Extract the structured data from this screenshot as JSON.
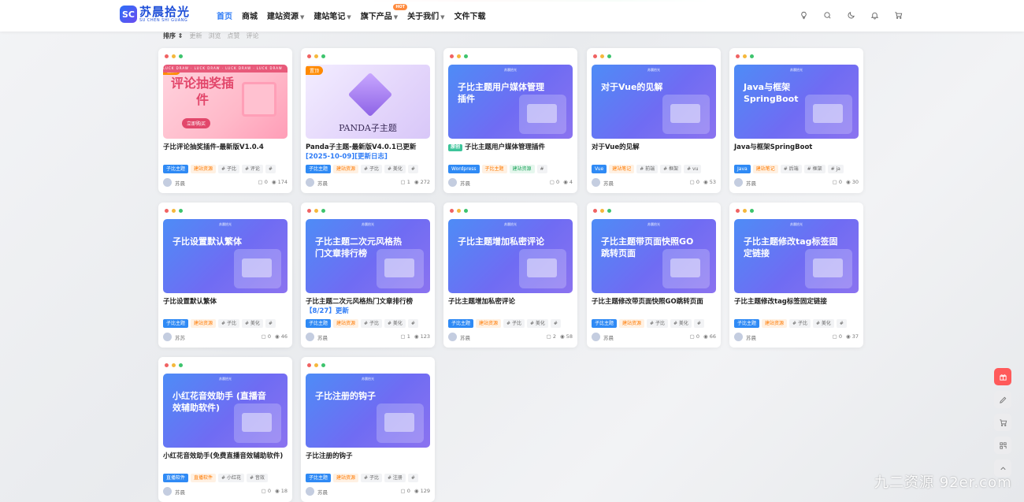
{
  "site": {
    "logo_mark": "SC",
    "logo_name": "苏晨拾光",
    "logo_sub": "SU CHEN SHI GUANG"
  },
  "nav": {
    "items": [
      {
        "label": "首页",
        "active": true
      },
      {
        "label": "商城"
      },
      {
        "label": "建站资源",
        "dropdown": true
      },
      {
        "label": "建站笔记",
        "dropdown": true
      },
      {
        "label": "旗下产品",
        "dropdown": true,
        "badge": "HOT"
      },
      {
        "label": "关于我们",
        "dropdown": true
      },
      {
        "label": "文件下载"
      }
    ],
    "icons": [
      "bulb-icon",
      "search-icon",
      "moon-icon",
      "bell-icon",
      "cart-icon"
    ]
  },
  "sort": {
    "label": "排序",
    "options": [
      "更新",
      "浏览",
      "点赞",
      "评论"
    ]
  },
  "posts": [
    {
      "title": "子比评论抽奖插件-最新版V1.0.4",
      "thumb": "评论抽奖插件",
      "ribbon": "置顶",
      "style": "pink",
      "tags": [
        "子比主题",
        "建站资源",
        "# 子比",
        "# 评论",
        "#"
      ],
      "author": "苏晨",
      "comments": "0",
      "views": "174"
    },
    {
      "title": "Panda子主题-最新版V4.0.1已更新",
      "subtitle": "[2025-10-09][更新日志]",
      "thumb": "PANDA子主题",
      "ribbon": "置顶",
      "style": "panda",
      "tags": [
        "子比主题",
        "建站资源",
        "# 子比",
        "# 美化",
        "#"
      ],
      "author": "苏晨",
      "comments": "1",
      "views": "272"
    },
    {
      "title": "子比主题用户媒体管理插件",
      "new": "原创",
      "thumb": "子比主题用户媒体管理插件",
      "tags": [
        "Wordpress",
        "子比主题",
        "建站资源",
        "#"
      ],
      "author": "苏晨",
      "comments": "0",
      "views": "4"
    },
    {
      "title": "对于Vue的见解",
      "thumb": "对于Vue的见解",
      "tags": [
        "Vue",
        "建站笔记",
        "# 前端",
        "# 框架",
        "# vu"
      ],
      "author": "苏晨",
      "comments": "0",
      "views": "53"
    },
    {
      "title": "Java与框架SpringBoot",
      "thumb": "Java与框架 SpringBoot",
      "tags": [
        "Java",
        "建站笔记",
        "# 后端",
        "# 框架",
        "# ja"
      ],
      "author": "苏晨",
      "comments": "0",
      "views": "30"
    },
    {
      "title": "子比设置默认繁体",
      "thumb": "子比设置默认繁体",
      "tags": [
        "子比主题",
        "建站资源",
        "# 子比",
        "# 美化",
        "#"
      ],
      "author": "苏苏",
      "comments": "0",
      "views": "46"
    },
    {
      "title": "子比主题二次元风格热门文章排行榜",
      "subtitle": "【8/27】更新",
      "thumb": "子比主题二次元风格热门文章排行榜",
      "tags": [
        "子比主题",
        "建站资源",
        "# 子比",
        "# 美化",
        "#"
      ],
      "author": "苏晨",
      "comments": "1",
      "views": "123"
    },
    {
      "title": "子比主题增加私密评论",
      "thumb": "子比主题增加私密评论",
      "tags": [
        "子比主题",
        "建站资源",
        "# 子比",
        "# 美化",
        "#"
      ],
      "author": "苏晨",
      "comments": "2",
      "views": "58"
    },
    {
      "title": "子比主题修改带页面快照GO跳转页面",
      "thumb": "子比主题带页面快照GO跳转页面",
      "tags": [
        "子比主题",
        "建站资源",
        "# 子比",
        "# 美化",
        "#"
      ],
      "author": "苏晨",
      "comments": "0",
      "views": "66"
    },
    {
      "title": "子比主题修改tag标签固定链接",
      "thumb": "子比主题修改tag标签固定链接",
      "tags": [
        "子比主题",
        "建站资源",
        "# 子比",
        "# 美化",
        "#"
      ],
      "author": "苏晨",
      "comments": "0",
      "views": "37"
    },
    {
      "title": "小红花音效助手(免费直播音效辅助软件)",
      "thumb": "小红花音效助手 (直播音效辅助软件)",
      "tags": [
        "直播软件",
        "直播软件",
        "# 小红花",
        "# 音效"
      ],
      "author": "苏晨",
      "comments": "0",
      "views": "18"
    },
    {
      "title": "子比注册的钩子",
      "thumb": "子比注册的钩子",
      "tags": [
        "子比主题",
        "建站资源",
        "# 子比",
        "# 注册",
        "#"
      ],
      "author": "苏晨",
      "comments": "0",
      "views": "129"
    }
  ],
  "side_tools": [
    "gift-icon",
    "edit-icon",
    "cart-icon",
    "qrcode-icon",
    "back-to-top-icon"
  ],
  "watermark": "九二资源 92er.com",
  "colors": {
    "accent": "#2f7cf6",
    "hot": "#ff8a3d",
    "tag_blue": "#2f8af5",
    "tag_orange": "#ff7a00"
  }
}
